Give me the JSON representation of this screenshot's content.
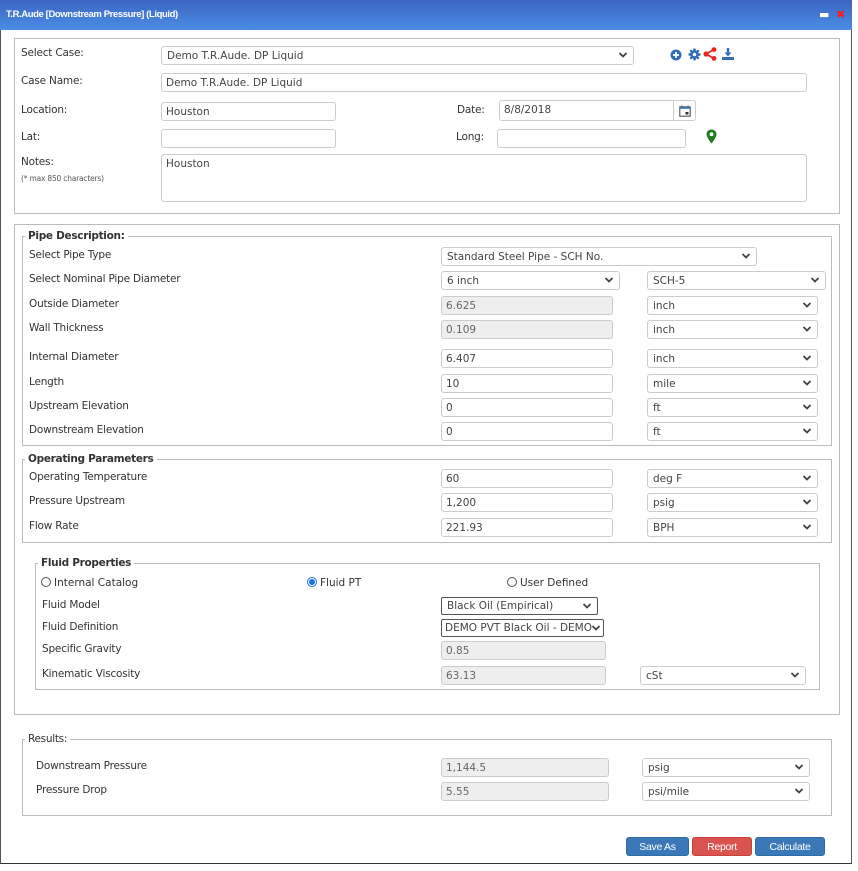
{
  "window": {
    "title": "T.R.Aude [Downstream Pressure] (Liquid)",
    "minimize_label": "▬",
    "close_label": "✖"
  },
  "case": {
    "select_case_label": "Select Case:",
    "select_case_value": "Demo T.R.Aude. DP Liquid",
    "case_name_label": "Case Name:",
    "case_name_value": "Demo T.R.Aude. DP Liquid",
    "location_label": "Location:",
    "location_value": "Houston",
    "date_label": "Date:",
    "date_value": "8/8/2018",
    "lat_label": "Lat:",
    "lat_value": "",
    "long_label": "Long:",
    "long_value": "",
    "notes_label": "Notes:",
    "notes_hint": "(* max 850 characters)",
    "notes_value": "Houston",
    "icons": [
      "add-icon",
      "gear-icon",
      "share-icon",
      "download-icon"
    ],
    "colors": {
      "icon_blue": "#2f6db5",
      "share_red": "#e8251f",
      "pin_green": "#1e7d1e"
    }
  },
  "pipe": {
    "legend": "Pipe Description:",
    "pipe_type_label": "Select Pipe Type",
    "pipe_type_value": "Standard Steel Pipe - SCH No.",
    "nominal_label": "Select Nominal Pipe Diameter",
    "nominal_value": "6 inch",
    "schedule_value": "SCH-5",
    "outside_diameter_label": "Outside Diameter",
    "outside_diameter_value": "6.625",
    "outside_diameter_unit": "inch",
    "wall_thickness_label": "Wall Thickness",
    "wall_thickness_value": "0.109",
    "wall_thickness_unit": "inch",
    "internal_diameter_label": "Internal Diameter",
    "internal_diameter_value": "6.407",
    "internal_diameter_unit": "inch",
    "length_label": "Length",
    "length_value": "10",
    "length_unit": "mile",
    "upstream_elevation_label": "Upstream Elevation",
    "upstream_elevation_value": "0",
    "upstream_elevation_unit": "ft",
    "downstream_elevation_label": "Downstream Elevation",
    "downstream_elevation_value": "0",
    "downstream_elevation_unit": "ft"
  },
  "operating": {
    "legend": "Operating Parameters",
    "temperature_label": "Operating Temperature",
    "temperature_value": "60",
    "temperature_unit": "deg F",
    "pressure_label": "Pressure Upstream",
    "pressure_value": "1,200",
    "pressure_unit": "psig",
    "flow_label": "Flow Rate",
    "flow_value": "221.93",
    "flow_unit": "BPH"
  },
  "fluid": {
    "legend": "Fluid Properties",
    "radio_internal": "Internal Catalog",
    "radio_fluidpt": "Fluid PT",
    "radio_user": "User Defined",
    "selected": "Fluid PT",
    "model_label": "Fluid Model",
    "model_value": "Black Oil (Empirical)",
    "definition_label": "Fluid Definition",
    "definition_value": "DEMO PVT Black Oil - DEMO",
    "sg_label": "Specific Gravity",
    "sg_value": "0.85",
    "viscosity_label": "Kinematic Viscosity",
    "viscosity_value": "63.13",
    "viscosity_unit": "cSt"
  },
  "results": {
    "legend": "Results:",
    "downstream_label": "Downstream Pressure",
    "downstream_value": "1,144.5",
    "downstream_unit": "psig",
    "drop_label": "Pressure Drop",
    "drop_value": "5.55",
    "drop_unit": "psi/mile"
  },
  "actions": {
    "save_as": "Save As",
    "report": "Report",
    "calculate": "Calculate"
  }
}
